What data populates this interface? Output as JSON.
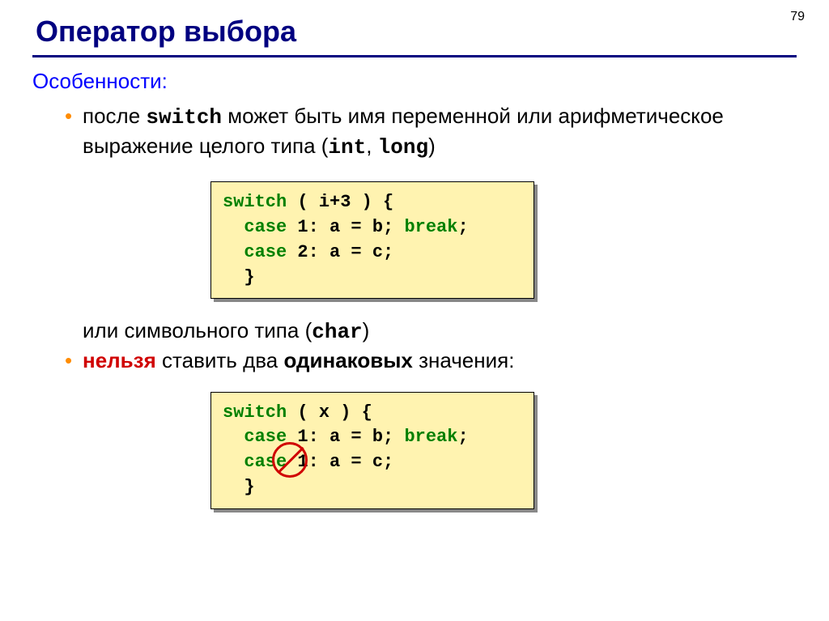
{
  "pageNumber": "79",
  "title": "Оператор выбора",
  "subheading": "Особенности:",
  "bullet1": {
    "pre": "после ",
    "kw": "switch",
    "mid": " может быть имя переменной или арифметическое выражение целого типа (",
    "t1": "int",
    "sep": ", ",
    "t2": "long",
    "post": ")"
  },
  "code1": {
    "l1a": "switch",
    "l1b": " ( i+3 ) {",
    "l2a": "  case",
    "l2b": " 1: a = b; ",
    "l2c": "break",
    "l2d": ";",
    "l3a": "  case",
    "l3b": " 2: a = c;",
    "l4": "  }"
  },
  "continuation": {
    "pre": "или символьного типа (",
    "t": "char",
    "post": ")"
  },
  "bullet2": {
    "w1": "нельзя",
    "mid": " ставить два ",
    "w2": "одинаковых",
    "post": " значения:"
  },
  "code2": {
    "l1a": "switch",
    "l1b": " ( x ) {",
    "l2a": "  case",
    "l2b": " 1: a = b; ",
    "l2c": "break",
    "l2d": ";",
    "l3a": "  case",
    "l3b": " 1: a = c;",
    "l4": "  }"
  }
}
